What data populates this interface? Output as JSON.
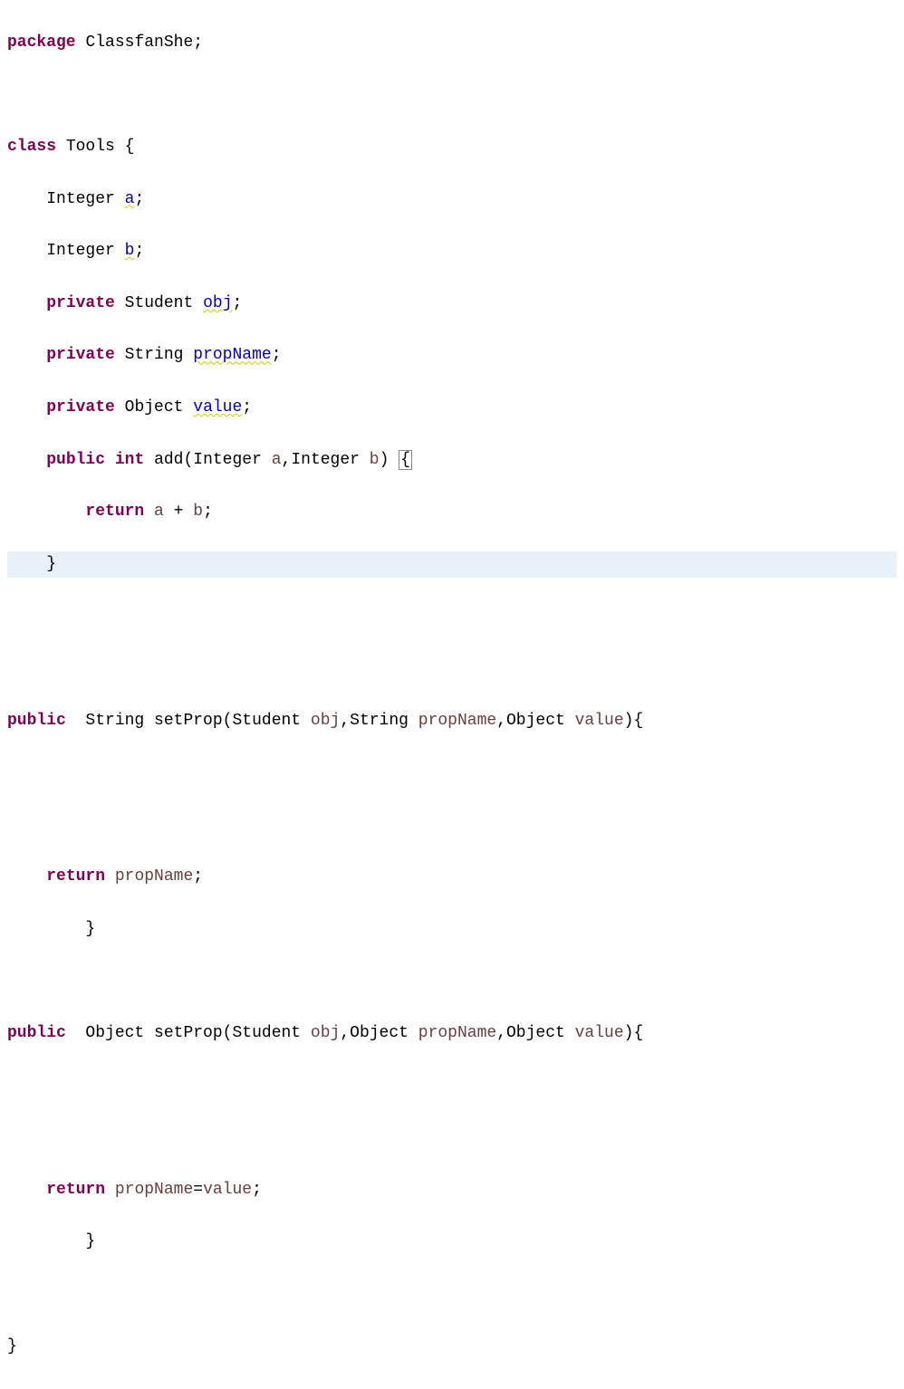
{
  "code": {
    "package_kw": "package",
    "package_name": "ClassfanShe",
    "semi": ";",
    "class_kw": "class",
    "class_name": "Tools",
    "open_brace": "{",
    "close_brace": "}",
    "field1_type": "Integer",
    "field1_name": "a",
    "field2_type": "Integer",
    "field2_name": "b",
    "private_kw": "private",
    "field3_type": "Student",
    "field3_name": "obj",
    "field4_type": "String",
    "field4_name": "propName",
    "field5_type": "Object",
    "field5_name": "value",
    "public_kw": "public",
    "int_kw": "int",
    "add_name": "add",
    "open_paren": "(",
    "close_paren": ")",
    "comma": ",",
    "param_a": "a",
    "param_b": "b",
    "return_kw": "return",
    "plus": "+",
    "setprop1_ret": "String",
    "setprop_name": "setProp",
    "setprop1_p1t": "Student",
    "setprop1_p1n": "obj",
    "setprop1_p2t": "String",
    "setprop1_p2n": "propName",
    "setprop1_p3t": "Object",
    "setprop1_p3n": "value",
    "setprop2_ret": "Object",
    "setprop2_p1t": "Student",
    "setprop2_p1n": "obj",
    "setprop2_p2t": "Object",
    "setprop2_p2n": "propName",
    "setprop2_p3t": "Object",
    "setprop2_p3n": "value",
    "eq": "="
  }
}
